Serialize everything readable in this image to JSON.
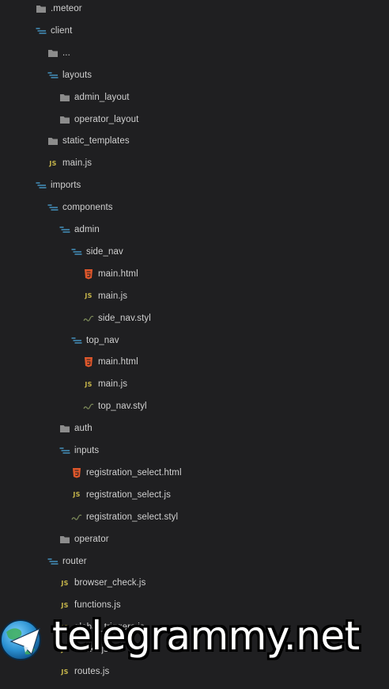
{
  "tree": [
    {
      "label": ".meteor",
      "icon": "folder-icon",
      "depth": 0
    },
    {
      "label": "client",
      "icon": "folder-open-icon",
      "depth": 0
    },
    {
      "label": "...",
      "icon": "folder-icon",
      "depth": 1
    },
    {
      "label": "layouts",
      "icon": "folder-open-icon",
      "depth": 1
    },
    {
      "label": "admin_layout",
      "icon": "folder-icon",
      "depth": 2
    },
    {
      "label": "operator_layout",
      "icon": "folder-icon",
      "depth": 2
    },
    {
      "label": "static_templates",
      "icon": "folder-icon",
      "depth": 1
    },
    {
      "label": "main.js",
      "icon": "js-file-icon",
      "depth": 1
    },
    {
      "label": "imports",
      "icon": "folder-open-icon",
      "depth": 0
    },
    {
      "label": "components",
      "icon": "folder-open-icon",
      "depth": 1
    },
    {
      "label": "admin",
      "icon": "folder-open-icon",
      "depth": 2
    },
    {
      "label": "side_nav",
      "icon": "folder-open-icon",
      "depth": 3
    },
    {
      "label": "main.html",
      "icon": "html5-file-icon",
      "depth": 4
    },
    {
      "label": "main.js",
      "icon": "js-file-icon",
      "depth": 4
    },
    {
      "label": "side_nav.styl",
      "icon": "stylus-file-icon",
      "depth": 4
    },
    {
      "label": "top_nav",
      "icon": "folder-open-icon",
      "depth": 3
    },
    {
      "label": "main.html",
      "icon": "html5-file-icon",
      "depth": 4
    },
    {
      "label": "main.js",
      "icon": "js-file-icon",
      "depth": 4
    },
    {
      "label": "top_nav.styl",
      "icon": "stylus-file-icon",
      "depth": 4
    },
    {
      "label": "auth",
      "icon": "folder-icon",
      "depth": 2
    },
    {
      "label": "inputs",
      "icon": "folder-open-icon",
      "depth": 2
    },
    {
      "label": "registration_select.html",
      "icon": "html5-file-icon",
      "depth": 3
    },
    {
      "label": "registration_select.js",
      "icon": "js-file-icon",
      "depth": 3
    },
    {
      "label": "registration_select.styl",
      "icon": "stylus-file-icon",
      "depth": 3
    },
    {
      "label": "operator",
      "icon": "folder-icon",
      "depth": 2
    },
    {
      "label": "router",
      "icon": "folder-open-icon",
      "depth": 1
    },
    {
      "label": "browser_check.js",
      "icon": "js-file-icon",
      "depth": 2
    },
    {
      "label": "functions.js",
      "icon": "js-file-icon",
      "depth": 2
    },
    {
      "label": "global_triggers.js",
      "icon": "js-file-icon",
      "depth": 2
    },
    {
      "label": "hooks.js",
      "icon": "js-file-icon",
      "depth": 2
    },
    {
      "label": "routes.js",
      "icon": "js-file-icon",
      "depth": 2
    }
  ],
  "icon_text": {
    "js": "JS"
  },
  "colors": {
    "background": "#1f1f21",
    "folder": "#8c8c8c",
    "folder_open": "#4aa3d6",
    "js": "#c6b54a",
    "html": "#e0572b",
    "stylus": "#7c8a5a",
    "text": "#d0d0d0"
  },
  "watermark": {
    "text": "telegrammy.net",
    "logo": "telegram-logo-icon"
  }
}
